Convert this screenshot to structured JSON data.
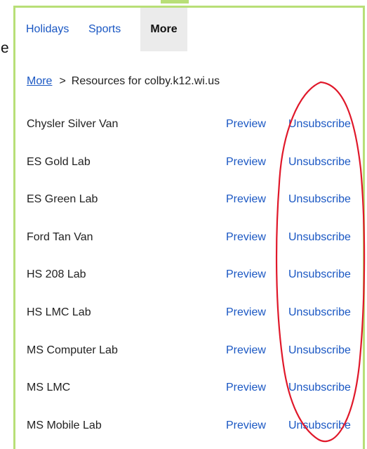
{
  "tabs": {
    "holidays": "Holidays",
    "sports": "Sports",
    "more": "More"
  },
  "stray_letter": "e",
  "breadcrumb": {
    "link": "More",
    "separator": ">",
    "current": "Resources for colby.k12.wi.us"
  },
  "rows": [
    {
      "name": "Chysler Silver Van",
      "preview": "Preview",
      "unsubscribe": "Unsubscribe"
    },
    {
      "name": "ES Gold Lab",
      "preview": "Preview",
      "unsubscribe": "Unsubscribe"
    },
    {
      "name": "ES Green Lab",
      "preview": "Preview",
      "unsubscribe": "Unsubscribe"
    },
    {
      "name": "Ford Tan Van",
      "preview": "Preview",
      "unsubscribe": "Unsubscribe"
    },
    {
      "name": "HS 208 Lab",
      "preview": "Preview",
      "unsubscribe": "Unsubscribe"
    },
    {
      "name": "HS LMC Lab",
      "preview": "Preview",
      "unsubscribe": "Unsubscribe"
    },
    {
      "name": "MS Computer Lab",
      "preview": "Preview",
      "unsubscribe": "Unsubscribe"
    },
    {
      "name": "MS LMC",
      "preview": "Preview",
      "unsubscribe": "Unsubscribe"
    },
    {
      "name": "MS Mobile Lab",
      "preview": "Preview",
      "unsubscribe": "Unsubscribe"
    }
  ],
  "colors": {
    "panel_border": "#b8df77",
    "link": "#1a57c3",
    "annotation": "#e0182a",
    "active_tab_bg": "#ebebeb"
  }
}
